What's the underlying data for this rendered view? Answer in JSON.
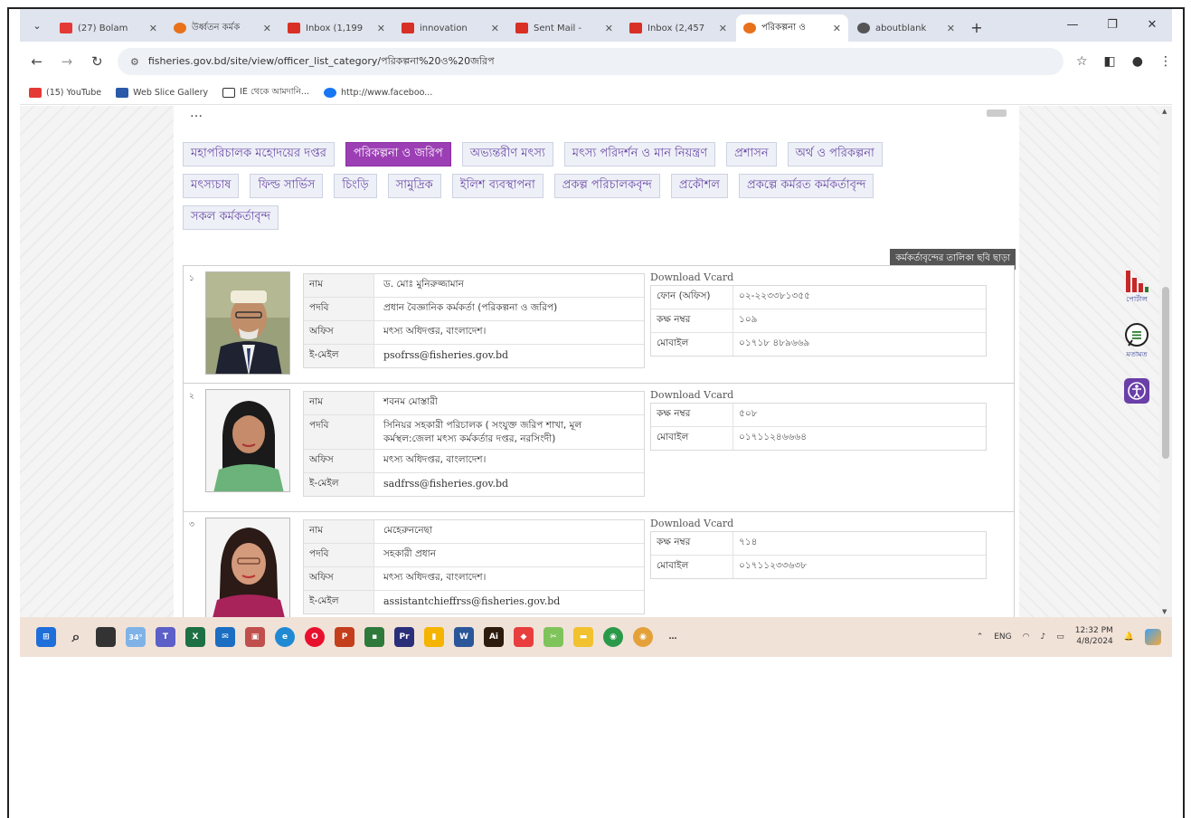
{
  "tabs": [
    {
      "title": "(27) Bolam",
      "color": "#e53935"
    },
    {
      "title": "উর্ধ্বতন কর্মক",
      "color": "#e8711a"
    },
    {
      "title": "Inbox (1,199",
      "color": "#d93025"
    },
    {
      "title": "innovation",
      "color": "#d93025"
    },
    {
      "title": "Sent Mail -",
      "color": "#d93025"
    },
    {
      "title": "Inbox (2,457",
      "color": "#d93025"
    },
    {
      "title": "পরিকল্পনা ও",
      "color": "#e8711a"
    },
    {
      "title": "aboutblank",
      "color": "#555555"
    }
  ],
  "address": {
    "url": "fisheries.gov.bd/site/view/officer_list_category/পরিকল্পনা%20ও%20জরিপ"
  },
  "bookmarks": [
    {
      "label": "(15) YouTube",
      "color": "#e53935"
    },
    {
      "label": "Web Slice Gallery",
      "color": "#2a5aa8"
    },
    {
      "label": "IE থেকে আমদানি...",
      "color": "#333333"
    },
    {
      "label": "http://www.faceboo...",
      "color": "#1877f2"
    }
  ],
  "menu": {
    "row1": [
      "মহাপরিচালক মহোদয়ের দপ্তর",
      "পরিকল্পনা ও জরিপ",
      "অভ্যন্তরীণ মৎস্য",
      "মৎস্য পরিদর্শন ও মান নিয়ন্ত্রণ",
      "প্রশাসন",
      "অর্থ ও পরিকল্পনা"
    ],
    "row2": [
      "মৎস্যচাষ",
      "ফিল্ড সার্ভিস",
      "চিংড়ি",
      "সামুদ্রিক",
      "ইলিশ ব্যবস্থাপনা",
      "প্রকল্প পরিচালকবৃন্দ",
      "প্রকৌশল",
      "প্রকল্পে কর্মরত কর্মকর্তাবৃন্দ"
    ],
    "row3": [
      "সকল কর্মকর্তাবৃন্দ"
    ]
  },
  "list_link": "কর্মকর্তাবৃন্দের তালিকা ছবি ছাড়া",
  "labels": {
    "name": "নাম",
    "designation": "পদবি",
    "office": "অফিস",
    "email": "ই-মেইল",
    "vcard": "Download Vcard",
    "phone_office": "ফোন (অফিস)",
    "room": "কক্ষ নম্বর",
    "mobile": "মোবাইল"
  },
  "officers": [
    {
      "num": "১",
      "name": "ড. মোঃ মুনিরুজ্জামান",
      "designation": "প্রধান বৈজ্ঞানিক কর্মকর্তা (পরিকল্পনা ও জরিপ)",
      "office": "মৎস্য অধিদপ্তর, বাংলাদেশ।",
      "email": "psofrss@fisheries.gov.bd",
      "phone_office": "০২-২২৩৩৮১৩৫৫",
      "room": "১০৯",
      "mobile": "০১৭১৮ ৪৮৯৬৬৯"
    },
    {
      "num": "২",
      "name": "শবনম মোস্তারী",
      "designation": "সিনিয়র সহকারী পরিচালক ( সংযুক্ত জরিপ শাখা, মূল কর্মস্থল:জেলা মৎস্য কর্মকর্তার দপ্তর, নরসিংদী)",
      "office": "মৎস্য অধিদপ্তর, বাংলাদেশ।",
      "email": "sadfrss@fisheries.gov.bd",
      "room": "৫০৮",
      "mobile": "০১৭১১২৪৬৬৬৪"
    },
    {
      "num": "৩",
      "name": "মেহেরুননেছা",
      "designation": "সহকারী প্রধান",
      "office": "মৎস্য অধিদপ্তর, বাংলাদেশ।",
      "email": "assistantchieffrss@fisheries.gov.bd",
      "room": "৭১৪",
      "mobile": "০১৭১১২৩৩৬৩৮"
    }
  ],
  "widgets": {
    "stats": "পোর্টাল",
    "feedback": "মতামত"
  },
  "taskbar": {
    "weather": "34°",
    "lang": "ENG",
    "time": "12:32 PM",
    "date": "4/8/2024"
  },
  "colors": {
    "accent": "#9c3fb5",
    "menu_text": "#6a4aa6",
    "taskbar": "#f1e2d8"
  }
}
